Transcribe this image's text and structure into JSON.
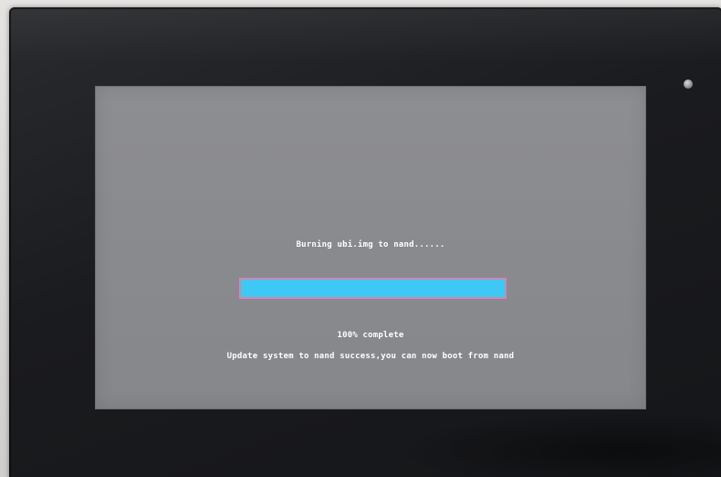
{
  "screen": {
    "status_title": "Burning ubi.img to nand......",
    "progress_text": "100% complete",
    "result_message": "Update system to nand success,you can now boot from nand"
  },
  "progress": {
    "fraction": 1.0,
    "fill_color": "#3ec8f5",
    "border_color": "#ff6ec8"
  },
  "colors": {
    "screen_background": "#8a8b8f",
    "text": "#ffffff",
    "bezel": "#1c1d20"
  }
}
